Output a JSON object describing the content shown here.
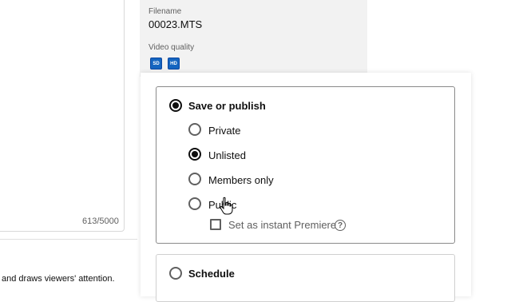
{
  "description": {
    "char_count": "613/5000",
    "hint": "and draws viewers' attention."
  },
  "video_info": {
    "filename_label": "Filename",
    "filename": "00023.MTS",
    "quality_label": "Video quality",
    "quality_badges": [
      "SD",
      "HD"
    ],
    "badge_color": "#1565c0"
  },
  "visibility": {
    "save_or_publish_label": "Save or publish",
    "options": [
      {
        "label": "Private",
        "selected": false
      },
      {
        "label": "Unlisted",
        "selected": true
      },
      {
        "label": "Members only",
        "selected": false
      },
      {
        "label": "Public",
        "selected": false
      }
    ],
    "premiere_label": "Set as instant Premiere",
    "premiere_checked": false,
    "help_icon": "help-circle-icon",
    "schedule_label": "Schedule"
  }
}
